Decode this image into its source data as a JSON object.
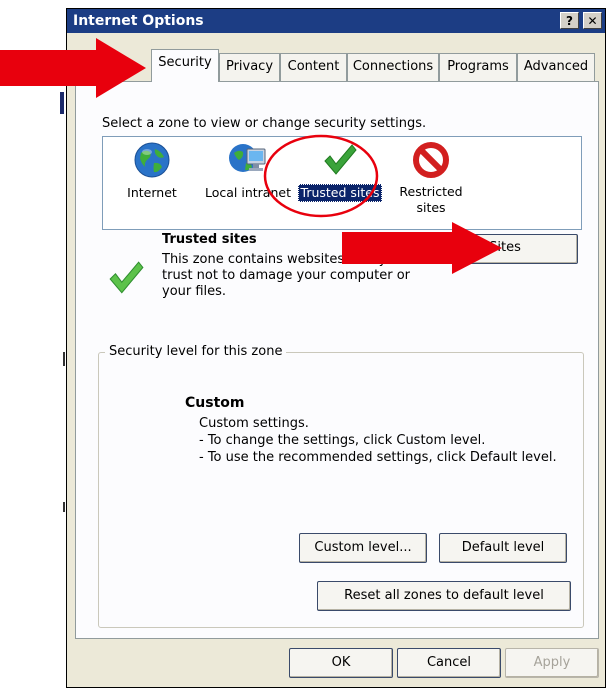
{
  "window": {
    "title": "Internet Options",
    "help_button": "?",
    "close_button": "✕"
  },
  "tabs": [
    {
      "label": "Security",
      "active": true
    },
    {
      "label": "Privacy"
    },
    {
      "label": "Content"
    },
    {
      "label": "Connections"
    },
    {
      "label": "Programs"
    },
    {
      "label": "Advanced"
    }
  ],
  "security": {
    "zone_prompt": "Select a zone to view or change security settings.",
    "zones": [
      {
        "label": "Internet",
        "icon": "globe-icon"
      },
      {
        "label": "Local intranet",
        "icon": "intranet-icon"
      },
      {
        "label": "Trusted sites",
        "icon": "checkmark-icon",
        "selected": true
      },
      {
        "label": "Restricted sites",
        "icon": "no-entry-icon"
      }
    ],
    "selected_zone": {
      "title": "Trusted sites",
      "description": [
        "This zone contains websites that you",
        "trust not to damage your computer or",
        "your files."
      ],
      "sites_button": "Sites"
    },
    "level_group": {
      "legend": "Security level for this zone",
      "level_name": "Custom",
      "lines": [
        "Custom settings.",
        "- To change the settings, click Custom level.",
        "- To use the recommended settings, click Default level."
      ],
      "custom_level_button": "Custom level...",
      "default_level_button": "Default level"
    },
    "reset_button": "Reset all zones to default level"
  },
  "footer": {
    "ok": "OK",
    "cancel": "Cancel",
    "apply": "Apply"
  },
  "annotation_color": "#e8000d"
}
